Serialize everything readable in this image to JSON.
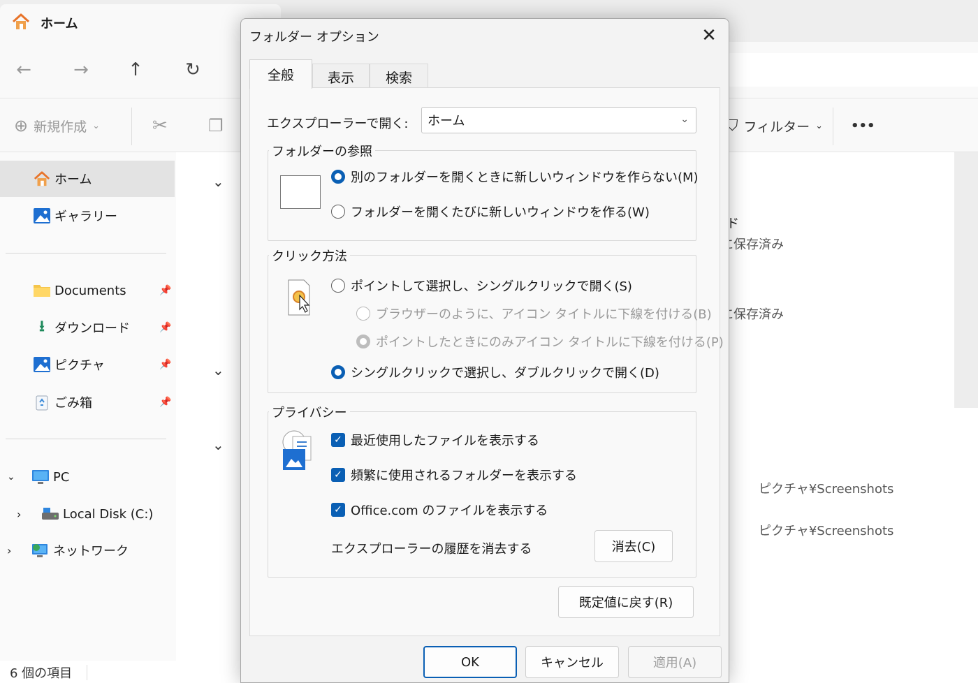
{
  "explorer": {
    "tab_title": "ホーム",
    "toolbar": {
      "new_label": "新規作成",
      "filter_label": "フィルター",
      "more_label": "•••"
    },
    "sidebar": {
      "quick": [
        {
          "label": "ホーム",
          "icon": "home-icon",
          "selected": true
        },
        {
          "label": "ギャラリー",
          "icon": "gallery-icon"
        }
      ],
      "pinned": [
        {
          "label": "Documents",
          "icon": "folder-icon"
        },
        {
          "label": "ダウンロード",
          "icon": "download-icon"
        },
        {
          "label": "ピクチャ",
          "icon": "pictures-icon"
        },
        {
          "label": "ごみ箱",
          "icon": "recycle-bin-icon"
        }
      ],
      "tree": [
        {
          "label": "PC",
          "icon": "pc-icon"
        },
        {
          "label": "Local Disk (C:)",
          "icon": "drive-icon"
        },
        {
          "label": "ネットワーク",
          "icon": "network-icon"
        }
      ]
    },
    "main": {
      "partial_texts": [
        "ド",
        "に保存済み",
        "に保存済み"
      ],
      "locations": [
        "ピクチャ¥Screenshots",
        "ピクチャ¥Screenshots"
      ]
    },
    "status": "6 個の項目"
  },
  "dialog": {
    "title": "フォルダー オプション",
    "tabs": [
      "全般",
      "表示",
      "検索"
    ],
    "open_in_label": "エクスプローラーで開く:",
    "open_in_value": "ホーム",
    "browse": {
      "title": "フォルダーの参照",
      "options": [
        {
          "label": "別のフォルダーを開くときに新しいウィンドウを作らない(M)",
          "checked": true
        },
        {
          "label": "フォルダーを開くたびに新しいウィンドウを作る(W)",
          "checked": false
        }
      ]
    },
    "click": {
      "title": "クリック方法",
      "options": [
        {
          "label": "ポイントして選択し、シングルクリックで開く(S)",
          "checked": false
        },
        {
          "label": "ブラウザーのように、アイコン タイトルに下線を付ける(B)",
          "checked": false,
          "disabled": true
        },
        {
          "label": "ポイントしたときにのみアイコン タイトルに下線を付ける(P)",
          "checked": true,
          "disabled": true
        },
        {
          "label": "シングルクリックで選択し、ダブルクリックで開く(D)",
          "checked": true
        }
      ]
    },
    "privacy": {
      "title": "プライバシー",
      "checks": [
        {
          "label": "最近使用したファイルを表示する",
          "checked": true
        },
        {
          "label": "頻繁に使用されるフォルダーを表示する",
          "checked": true
        },
        {
          "label": "Office.com のファイルを表示する",
          "checked": true
        }
      ],
      "clear_history_label": "エクスプローラーの履歴を消去する",
      "clear_button": "消去(C)"
    },
    "restore_button": "既定値に戻す(R)",
    "ok_button": "OK",
    "cancel_button": "キャンセル",
    "apply_button": "適用(A)",
    "accent_color": "#0a5fb4"
  }
}
